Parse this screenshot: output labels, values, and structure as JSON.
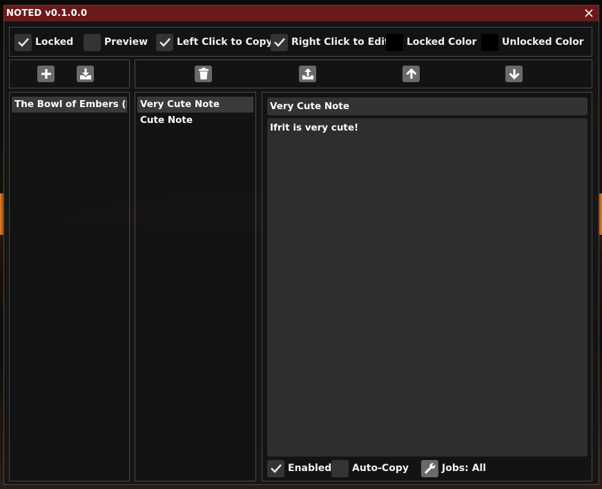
{
  "window": {
    "title": "NOTED v0.1.0.0",
    "title_bar_color": "#6b1a1a"
  },
  "options": [
    {
      "label": "Locked",
      "checked": true
    },
    {
      "label": "Preview",
      "checked": false
    },
    {
      "label": "Left Click to Copy",
      "checked": true
    },
    {
      "label": "Right Click to Edit",
      "checked": true
    },
    {
      "label": "Locked Color",
      "swatch": "#000000"
    },
    {
      "label": "Unlocked Color",
      "swatch": "#000000"
    }
  ],
  "toolbar_left": [
    "plus-icon",
    "import-icon"
  ],
  "toolbar_right": [
    "trash-icon",
    "export-icon",
    "arrow-up-icon",
    "arrow-down-icon"
  ],
  "duties": [
    {
      "label": "The Bowl of Embers (Hard)",
      "selected": true
    }
  ],
  "notes": [
    {
      "label": "Very Cute Note",
      "selected": true
    },
    {
      "label": "Cute Note",
      "selected": false
    }
  ],
  "editor": {
    "title": "Very Cute Note",
    "body": "Ifrit is very cute!"
  },
  "footer": {
    "enabled_label": "Enabled",
    "enabled_checked": true,
    "autocopy_label": "Auto-Copy",
    "autocopy_checked": false,
    "jobs_label": "Jobs: All"
  }
}
